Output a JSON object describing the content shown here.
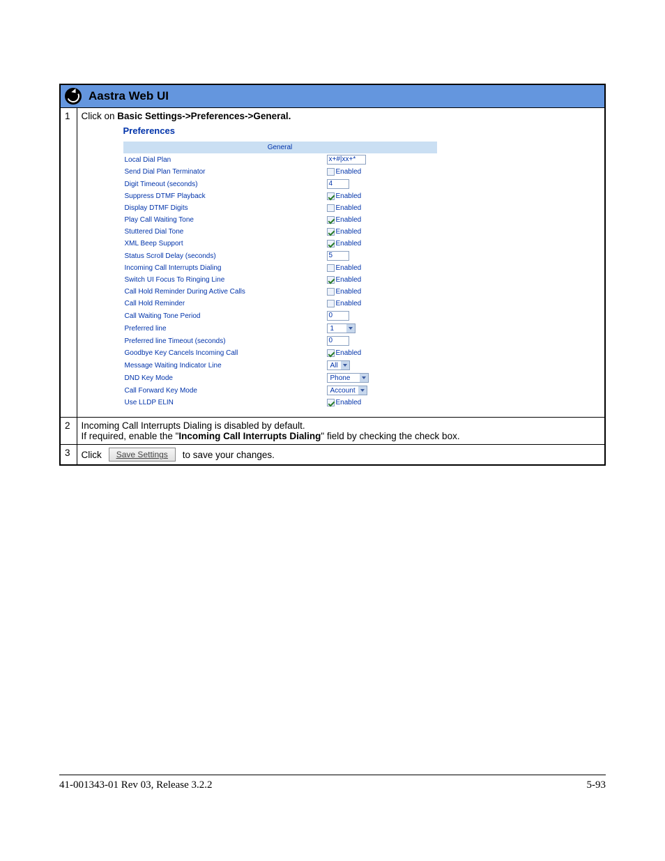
{
  "header": {
    "title": "Aastra Web UI"
  },
  "steps": {
    "s1": {
      "num": "1",
      "pre": "Click on ",
      "bold": "Basic Settings->Preferences->General."
    },
    "s2": {
      "num": "2",
      "line1": "Incoming Call Interrupts Dialing is disabled by default.",
      "line2a": "If required, enable the \"",
      "line2b": "Incoming Call Interrupts Dialing",
      "line2c": "\" field by checking the check box."
    },
    "s3": {
      "num": "3",
      "pre": "Click",
      "btn": "Save Settings",
      "post": "to save your changes."
    }
  },
  "prefs": {
    "title": "Preferences",
    "general": "General",
    "rows": {
      "local_dial_plan": {
        "label": "Local Dial Plan",
        "value": "x+#|xx+*"
      },
      "send_dial_plan_terminator": {
        "label": "Send Dial Plan Terminator",
        "enabled": "Enabled"
      },
      "digit_timeout": {
        "label": "Digit Timeout (seconds)",
        "value": "4"
      },
      "suppress_dtmf_playback": {
        "label": "Suppress DTMF Playback",
        "enabled": "Enabled"
      },
      "display_dtmf_digits": {
        "label": "Display DTMF Digits",
        "enabled": "Enabled"
      },
      "play_call_waiting_tone": {
        "label": "Play Call Waiting Tone",
        "enabled": "Enabled"
      },
      "stuttered_dial_tone": {
        "label": "Stuttered Dial Tone",
        "enabled": "Enabled"
      },
      "xml_beep_support": {
        "label": "XML Beep Support",
        "enabled": "Enabled"
      },
      "status_scroll_delay": {
        "label": "Status Scroll Delay (seconds)",
        "value": "5"
      },
      "incoming_call_interrupts_dialing": {
        "label": "Incoming Call Interrupts Dialing",
        "enabled": "Enabled"
      },
      "switch_ui_focus": {
        "label": "Switch UI Focus To Ringing Line",
        "enabled": "Enabled"
      },
      "call_hold_reminder_active": {
        "label": "Call Hold Reminder During Active Calls",
        "enabled": "Enabled"
      },
      "call_hold_reminder": {
        "label": "Call Hold Reminder",
        "enabled": "Enabled"
      },
      "call_waiting_tone_period": {
        "label": "Call Waiting Tone Period",
        "value": "0"
      },
      "preferred_line": {
        "label": "Preferred line",
        "value": "1"
      },
      "preferred_line_timeout": {
        "label": "Preferred line Timeout (seconds)",
        "value": "0"
      },
      "goodbye_key": {
        "label": "Goodbye Key Cancels Incoming Call",
        "enabled": "Enabled"
      },
      "mwi_line": {
        "label": "Message Waiting Indicator Line",
        "value": "All"
      },
      "dnd_key_mode": {
        "label": "DND Key Mode",
        "value": "Phone"
      },
      "call_forward_key_mode": {
        "label": "Call Forward Key Mode",
        "value": "Account"
      },
      "use_lldp_elin": {
        "label": "Use LLDP ELIN",
        "enabled": "Enabled"
      }
    }
  },
  "footer": {
    "left": "41-001343-01 Rev 03, Release 3.2.2",
    "right": "5-93"
  }
}
